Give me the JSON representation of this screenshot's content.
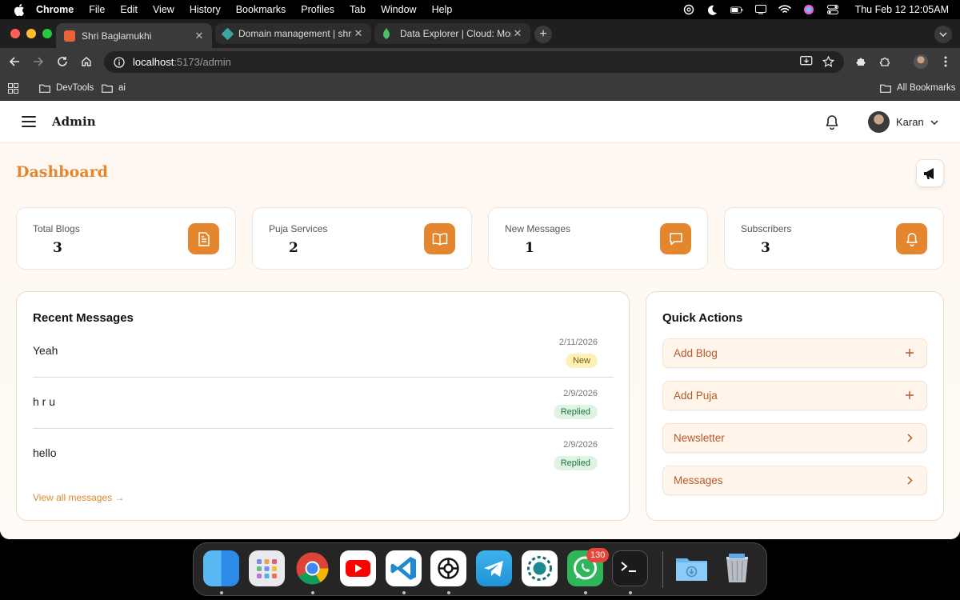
{
  "menubar": {
    "items": [
      "Chrome",
      "File",
      "Edit",
      "View",
      "History",
      "Bookmarks",
      "Profiles",
      "Tab",
      "Window",
      "Help"
    ],
    "clock": "Thu Feb 12  12:05AM"
  },
  "browser": {
    "tabs": [
      {
        "title": "Shri Baglamukhi",
        "active": true
      },
      {
        "title": "Domain management | shriba",
        "active": false
      },
      {
        "title": "Data Explorer | Cloud: Mongo",
        "active": false
      }
    ],
    "url_host": "localhost",
    "url_path": ":5173/admin",
    "bookmarks": [
      "DevTools",
      "ai"
    ],
    "all_bookmarks": "All Bookmarks"
  },
  "app": {
    "brand": "Admin",
    "user": "Karan",
    "page_title": "Dashboard",
    "stats": [
      {
        "label": "Total Blogs",
        "value": "3",
        "icon": "document-icon"
      },
      {
        "label": "Puja Services",
        "value": "2",
        "icon": "book-open-icon"
      },
      {
        "label": "New Messages",
        "value": "1",
        "icon": "message-icon"
      },
      {
        "label": "Subscribers",
        "value": "3",
        "icon": "bell-icon"
      }
    ],
    "recent": {
      "title": "Recent Messages",
      "messages": [
        {
          "text": "Yeah",
          "date": "2/11/2026",
          "status": "New"
        },
        {
          "text": "h r u",
          "date": "2/9/2026",
          "status": "Replied"
        },
        {
          "text": "hello",
          "date": "2/9/2026",
          "status": "Replied"
        }
      ],
      "view_all": "View all messages →"
    },
    "quick": {
      "title": "Quick Actions",
      "actions": [
        {
          "label": "Add Blog",
          "icon": "plus-icon"
        },
        {
          "label": "Add Puja",
          "icon": "plus-icon"
        },
        {
          "label": "Newsletter",
          "icon": "chevron-right-icon"
        },
        {
          "label": "Messages",
          "icon": "chevron-right-icon"
        }
      ]
    }
  },
  "dock": {
    "whatsapp_badge": "130",
    "colors": {
      "accent": "#e4862e",
      "badge": "#e6463a"
    }
  }
}
